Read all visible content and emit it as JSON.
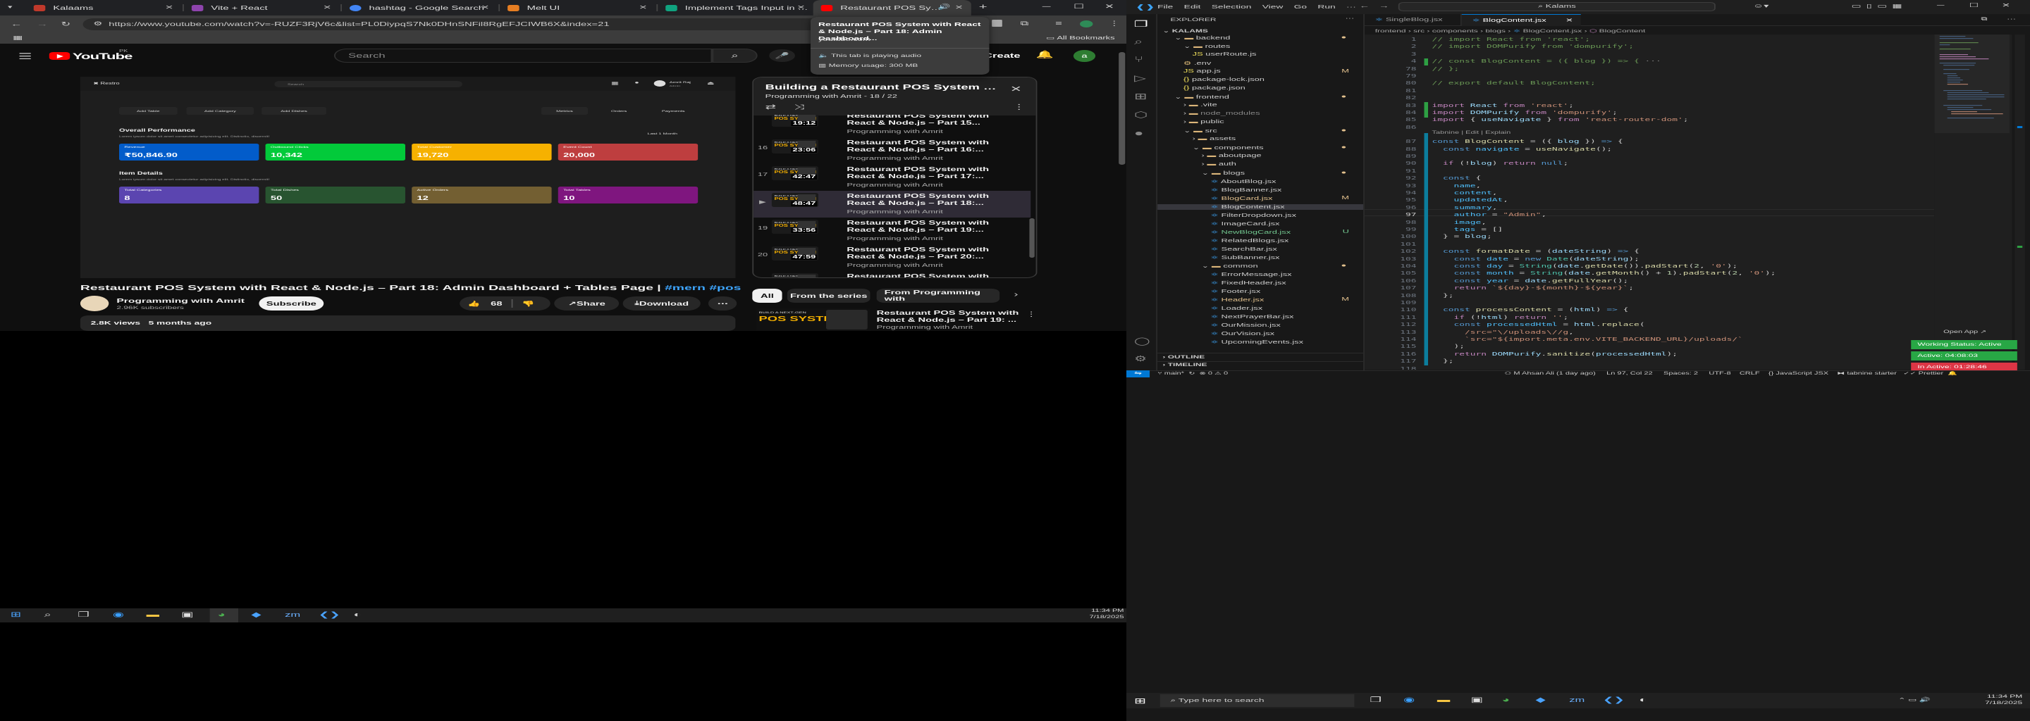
{
  "chrome": {
    "tabs": [
      {
        "label": "Kalaams",
        "color": "#c0392b"
      },
      {
        "label": "Vite + React",
        "color": "#8e44ad"
      },
      {
        "label": "hashtag - Google Search",
        "color": "#4285f4"
      },
      {
        "label": "Melt UI",
        "color": "#e67e22"
      },
      {
        "label": "Implement Tags Input in Blog",
        "color": "#10a37f"
      },
      {
        "label": "Restaurant POS System w",
        "color": "#ff0000"
      }
    ],
    "url": "https://www.youtube.com/watch?v=-RUZF3RjV6c&list=PL0DiypqS7Nk0DHnSNFil8RgEFJCIWB6X&index=21",
    "bookmarks": "All Bookmarks",
    "hover_card": {
      "title": "Restaurant POS System with React & Node.js – Part 18: Admin Dashboard...",
      "domain": "youtube.com",
      "audio": "This tab is playing audio",
      "memory": "Memory usage: 300 MB"
    }
  },
  "youtube": {
    "logo": "YouTube",
    "region": "PK",
    "search_placeholder": "Search",
    "create_label": "Create",
    "avatar_letter": "a",
    "video_title": "Restaurant POS System with React & Node.js – Part 18: Admin Dashboard + Tables Page |",
    "video_tags": "#mern #pos",
    "channel": "Programming with Amrit",
    "subscribers": "2.96K subscribers",
    "subscribe": "Subscribe",
    "likes": "68",
    "share": "Share",
    "download": "Download",
    "views": "2.8K views",
    "age": "5 months ago",
    "playlist": {
      "title": "Building a Restaurant POS System w...",
      "subtitle": "Programming with Amrit - 18 / 22",
      "items": [
        {
          "num": "",
          "title": "Restaurant POS System with React & Node.js – Part 15...",
          "channel": "Programming with Amrit",
          "duration": "19:12"
        },
        {
          "num": "16",
          "title": "Restaurant POS System with React & Node.js – Part 16:...",
          "channel": "Programming with Amrit",
          "duration": "23:06"
        },
        {
          "num": "17",
          "title": "Restaurant POS System with React & Node.js – Part 17:...",
          "channel": "Programming with Amrit",
          "duration": "42:47"
        },
        {
          "num": "▶",
          "title": "Restaurant POS System with React & Node.js – Part 18:...",
          "channel": "Programming with Amrit",
          "duration": "48:47"
        },
        {
          "num": "19",
          "title": "Restaurant POS System with React & Node.js – Part 19:...",
          "channel": "Programming with Amrit",
          "duration": "33:56"
        },
        {
          "num": "20",
          "title": "Restaurant POS System with React & Node.js – Part 20:...",
          "channel": "Programming with Amrit",
          "duration": "47:59"
        },
        {
          "num": "21",
          "title": "Restaurant POS System with React & Node.js – Part 21:...",
          "channel": "Programming with Amrit",
          "duration": ""
        }
      ]
    },
    "chips": [
      "All",
      "From the series",
      "From Programming with"
    ],
    "next_video": {
      "title": "Restaurant POS System with React & Node.js – Part 19: ...",
      "channel": "Programming with Amrit",
      "thumb_text": "POS SYSTEM"
    }
  },
  "app_preview": {
    "brand": "Restro",
    "search": "Search",
    "user": "Amrit Raj",
    "role": "Admin",
    "buttons": [
      "Add Table",
      "Add Category",
      "Add Dishes"
    ],
    "tabs": [
      "Metrics",
      "Orders",
      "Payments"
    ],
    "overall_title": "Overall Performance",
    "overall_sub": "Lorem ipsum dolor sit amet consectetur adipisicing elit. Distinctio, discernit!",
    "period": "Last 1 Month",
    "metrics": [
      {
        "label": "Revenue",
        "value": "₹50,846.90",
        "color": "#025cca"
      },
      {
        "label": "Outbound Clicks",
        "value": "10,342",
        "color": "#02ca3a"
      },
      {
        "label": "Total Customer",
        "value": "19,720",
        "color": "#f6b100"
      },
      {
        "label": "Event Count",
        "value": "20,000",
        "color": "#be3e3f"
      }
    ],
    "item_title": "Item Details",
    "item_sub": "Lorem ipsum dolor sit amet consectetur adipisicing elit. Distinctio, discernit!",
    "items": [
      {
        "label": "Total Categories",
        "value": "8",
        "color": "#5b45b0"
      },
      {
        "label": "Total Dishes",
        "value": "50",
        "color": "#285430"
      },
      {
        "label": "Active Orders",
        "value": "12",
        "color": "#735f32"
      },
      {
        "label": "Total Tables",
        "value": "10",
        "color": "#7f167f"
      }
    ],
    "thumb_text": "POS SYSTEM"
  },
  "taskbar_small": {
    "time": "11:34 PM",
    "date": "7/18/2025"
  },
  "vscode": {
    "menu": [
      "File",
      "Edit",
      "Selection",
      "View",
      "Go",
      "Run"
    ],
    "search": "Kalams",
    "explorer_title": "EXPLORER",
    "root": "KALAMS",
    "tree": [
      {
        "label": "backend",
        "indent": 1,
        "type": "folder",
        "open": true,
        "dot": true
      },
      {
        "label": "routes",
        "indent": 2,
        "type": "folder",
        "open": true
      },
      {
        "label": "userRoute.js",
        "indent": 3,
        "type": "js"
      },
      {
        "label": ".env",
        "indent": 2,
        "type": "file"
      },
      {
        "label": "app.js",
        "indent": 2,
        "type": "js",
        "badge": "M"
      },
      {
        "label": "package-lock.json",
        "indent": 2,
        "type": "json"
      },
      {
        "label": "package.json",
        "indent": 2,
        "type": "json"
      },
      {
        "label": "frontend",
        "indent": 1,
        "type": "folder",
        "open": true,
        "dot": true
      },
      {
        "label": ".vite",
        "indent": 2,
        "type": "folder"
      },
      {
        "label": "node_modules",
        "indent": 2,
        "type": "folder",
        "dim": true
      },
      {
        "label": "public",
        "indent": 2,
        "type": "folder"
      },
      {
        "label": "src",
        "indent": 2,
        "type": "folder",
        "open": true,
        "dot": true
      },
      {
        "label": "assets",
        "indent": 3,
        "type": "folder"
      },
      {
        "label": "components",
        "indent": 3,
        "type": "folder",
        "open": true,
        "dot": true
      },
      {
        "label": "aboutpage",
        "indent": 4,
        "type": "folder"
      },
      {
        "label": "auth",
        "indent": 4,
        "type": "folder"
      },
      {
        "label": "blogs",
        "indent": 4,
        "type": "folder",
        "open": true,
        "dot": true
      },
      {
        "label": "AboutBlog.jsx",
        "indent": 5,
        "type": "jsx"
      },
      {
        "label": "BlogBanner.jsx",
        "indent": 5,
        "type": "jsx"
      },
      {
        "label": "BlogCard.jsx",
        "indent": 5,
        "type": "jsx",
        "badge": "M",
        "mod": true
      },
      {
        "label": "BlogContent.jsx",
        "indent": 5,
        "type": "jsx",
        "active": true
      },
      {
        "label": "FilterDropdown.jsx",
        "indent": 5,
        "type": "jsx"
      },
      {
        "label": "ImageCard.jsx",
        "indent": 5,
        "type": "jsx"
      },
      {
        "label": "NewBlogCard.jsx",
        "indent": 5,
        "type": "jsx",
        "badge": "U",
        "new": true
      },
      {
        "label": "RelatedBlogs.jsx",
        "indent": 5,
        "type": "jsx"
      },
      {
        "label": "SearchBar.jsx",
        "indent": 5,
        "type": "jsx"
      },
      {
        "label": "SubBanner.jsx",
        "indent": 5,
        "type": "jsx"
      },
      {
        "label": "common",
        "indent": 4,
        "type": "folder",
        "open": true,
        "dot": true
      },
      {
        "label": "ErrorMessage.jsx",
        "indent": 5,
        "type": "jsx"
      },
      {
        "label": "FixedHeader.jsx",
        "indent": 5,
        "type": "jsx"
      },
      {
        "label": "Footer.jsx",
        "indent": 5,
        "type": "jsx"
      },
      {
        "label": "Header.jsx",
        "indent": 5,
        "type": "jsx",
        "badge": "M",
        "mod": true
      },
      {
        "label": "Loader.jsx",
        "indent": 5,
        "type": "jsx"
      },
      {
        "label": "NextPrayerBar.jsx",
        "indent": 5,
        "type": "jsx"
      },
      {
        "label": "OurMission.jsx",
        "indent": 5,
        "type": "jsx"
      },
      {
        "label": "OurVision.jsx",
        "indent": 5,
        "type": "jsx"
      },
      {
        "label": "UpcomingEvents.jsx",
        "indent": 5,
        "type": "jsx"
      }
    ],
    "outline": "OUTLINE",
    "timeline": "TIMELINE",
    "tabs": [
      {
        "label": "SingleBlog.jsx",
        "active": false
      },
      {
        "label": "BlogContent.jsx",
        "active": true
      }
    ],
    "breadcrumb": [
      "frontend",
      "src",
      "components",
      "blogs",
      "BlogContent.jsx",
      "BlogContent"
    ],
    "lens": "Tabnine | Edit | Explain",
    "code_lines": [
      {
        "n": "1",
        "html": "<span class='cm'>// import React from 'react';</span>"
      },
      {
        "n": "2",
        "html": "<span class='cm'>// import DOMPurify from 'dompurify';</span>"
      },
      {
        "n": "3",
        "html": ""
      },
      {
        "n": "4",
        "html": "<span class='cm'>// const BlogContent = ({ blog }) => {</span> <span style='color:#888'>···</span>"
      },
      {
        "n": "78",
        "html": "<span class='cm'>// };</span>"
      },
      {
        "n": "79",
        "html": ""
      },
      {
        "n": "80",
        "html": "<span class='cm'>// export default BlogContent;</span>"
      },
      {
        "n": "81",
        "html": ""
      },
      {
        "n": "82",
        "html": ""
      },
      {
        "n": "83",
        "html": "<span class='kw'>import</span> <span class='vr'>React</span> <span class='kw'>from</span> <span class='str'>'react'</span>;"
      },
      {
        "n": "84",
        "html": "<span class='kw'>import</span> <span class='vr'>DOMPurify</span> <span class='kw'>from</span> <span class='str'>'dompurify'</span>;"
      },
      {
        "n": "85",
        "html": "<span class='kw'>import</span> { <span class='vr'>useNavigate</span> } <span class='kw'>from</span> <span class='str'>'react-router-dom'</span>;"
      },
      {
        "n": "86",
        "html": ""
      },
      {
        "n": "87",
        "html": "<span class='bl'>const</span> <span class='fn'>BlogContent</span> = ({ <span class='vr'>blog</span> }) <span class='bl'>=&gt;</span> {"
      },
      {
        "n": "88",
        "html": "  <span class='bl'>const</span> <span class='cn'>navigate</span> = <span class='fn'>useNavigate</span>();"
      },
      {
        "n": "89",
        "html": ""
      },
      {
        "n": "90",
        "html": "  <span class='kw'>if</span> (!<span class='vr'>blog</span>) <span class='kw'>return</span> <span class='bl'>null</span>;"
      },
      {
        "n": "91",
        "html": ""
      },
      {
        "n": "92",
        "html": "  <span class='bl'>const</span> {"
      },
      {
        "n": "93",
        "html": "    <span class='cn'>name</span>,"
      },
      {
        "n": "94",
        "html": "    <span class='cn'>content</span>,"
      },
      {
        "n": "95",
        "html": "    <span class='cn'>updatedAt</span>,"
      },
      {
        "n": "96",
        "html": "    <span class='cn'>summary</span>,"
      },
      {
        "n": "97",
        "html": "    <span class='cn'>author</span> = <span class='str'>\"Admin\"</span>,"
      },
      {
        "n": "98",
        "html": "    <span class='cn'>image</span>,"
      },
      {
        "n": "99",
        "html": "    <span class='cn'>tags</span> = []"
      },
      {
        "n": "100",
        "html": "  } = <span class='vr'>blog</span>;"
      },
      {
        "n": "101",
        "html": ""
      },
      {
        "n": "102",
        "html": "  <span class='bl'>const</span> <span class='fn'>formatDate</span> = (<span class='vr'>dateString</span>) <span class='bl'>=&gt;</span> {"
      },
      {
        "n": "103",
        "html": "    <span class='bl'>const</span> <span class='cn'>date</span> = <span class='bl'>new</span> <span class='ty'>Date</span>(<span class='vr'>dateString</span>);"
      },
      {
        "n": "104",
        "html": "    <span class='bl'>const</span> <span class='cn'>day</span> = <span class='ty'>String</span>(<span class='vr'>date</span>.<span class='fn'>getDate</span>()).<span class='fn'>padStart</span>(<span class='nb'>2</span>, <span class='str'>'0'</span>);"
      },
      {
        "n": "105",
        "html": "    <span class='bl'>const</span> <span class='cn'>month</span> = <span class='ty'>String</span>(<span class='vr'>date</span>.<span class='fn'>getMonth</span>() + <span class='nb'>1</span>).<span class='fn'>padStart</span>(<span class='nb'>2</span>, <span class='str'>'0'</span>);"
      },
      {
        "n": "106",
        "html": "    <span class='bl'>const</span> <span class='cn'>year</span> = <span class='vr'>date</span>.<span class='fn'>getFullYear</span>();"
      },
      {
        "n": "107",
        "html": "    <span class='kw'>return</span> <span class='str'>`${day}-${month}-${year}`</span>;"
      },
      {
        "n": "108",
        "html": "  };"
      },
      {
        "n": "109",
        "html": ""
      },
      {
        "n": "110",
        "html": "  <span class='bl'>const</span> <span class='fn'>processContent</span> = (<span class='vr'>html</span>) <span class='bl'>=&gt;</span> {"
      },
      {
        "n": "111",
        "html": "    <span class='kw'>if</span> (!<span class='vr'>html</span>) <span class='kw'>return</span> <span class='str'>''</span>;"
      },
      {
        "n": "112",
        "html": "    <span class='bl'>const</span> <span class='cn'>processedHtml</span> = <span class='vr'>html</span>.<span class='fn'>replace</span>("
      },
      {
        "n": "113",
        "html": "      <span class='str'>/src=\"\\/uploads\\//g</span>,"
      },
      {
        "n": "114",
        "html": "      <span class='str'>`src=\"${import.meta.env.VITE_BACKEND_URL}/uploads/`</span>"
      },
      {
        "n": "115",
        "html": "    );"
      },
      {
        "n": "116",
        "html": "    <span class='kw'>return</span> <span class='vr'>DOMPurify</span>.<span class='fn'>sanitize</span>(<span class='vr'>processedHtml</span>);"
      },
      {
        "n": "117",
        "html": "  };"
      },
      {
        "n": "118",
        "html": ""
      }
    ],
    "open_app": "Open App ↗",
    "working": "Working Status: Active",
    "active": "Active: 04:08:03",
    "inactive": "In Active: 01:28:46",
    "status": {
      "branch": "main*",
      "errors": "0 ⚠ 0",
      "blame": "M Ahsan Ali (1 day ago)",
      "position": "Ln 97, Col 22",
      "spaces": "Spaces: 2",
      "encoding": "UTF-8",
      "eol": "CRLF",
      "lang": "JavaScript JSX",
      "tabnine": "tabnine starter",
      "prettier": "Prettier"
    }
  },
  "windows": {
    "search_placeholder": "Type here to search",
    "time": "11:34 PM",
    "date": "7/18/2025"
  }
}
